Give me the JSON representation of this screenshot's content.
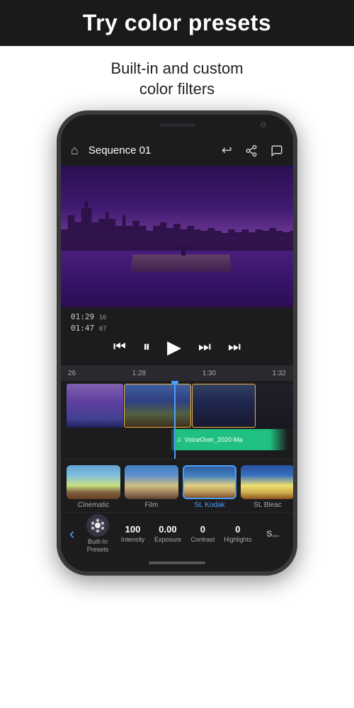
{
  "header": {
    "banner_text": "Try color presets",
    "subtitle_line1": "Built-in and custom",
    "subtitle_line2": "color filters"
  },
  "app_bar": {
    "title": "Sequence 01",
    "back_icon": "undo",
    "share_icon": "share",
    "chat_icon": "chat"
  },
  "timecode": {
    "current": "01:29",
    "current_frame": "16",
    "total": "01:47",
    "total_frame": "07"
  },
  "ruler": {
    "marks": [
      "26",
      "1:28",
      "1:30",
      "1:32"
    ]
  },
  "audio_track": {
    "note_icon": "♫",
    "label": "VoiceOver_2020-Ma"
  },
  "presets": [
    {
      "id": "cinematic",
      "label": "Cinematic",
      "active": false
    },
    {
      "id": "film",
      "label": "Film",
      "active": false
    },
    {
      "id": "sl-kodak",
      "label": "SL Kodak",
      "active": true
    },
    {
      "id": "sl-bleach",
      "label": "SL Bleac",
      "active": false
    }
  ],
  "toolbar": {
    "back_label": "‹",
    "built_in_presets_label": "Built-In\nPresets",
    "intensity_label": "Intensity",
    "intensity_value": "100",
    "exposure_label": "Exposure",
    "exposure_value": "0.00",
    "contrast_label": "Contrast",
    "contrast_value": "0",
    "highlights_label": "Highlights",
    "highlights_value": "0",
    "shadows_label": "S..."
  }
}
